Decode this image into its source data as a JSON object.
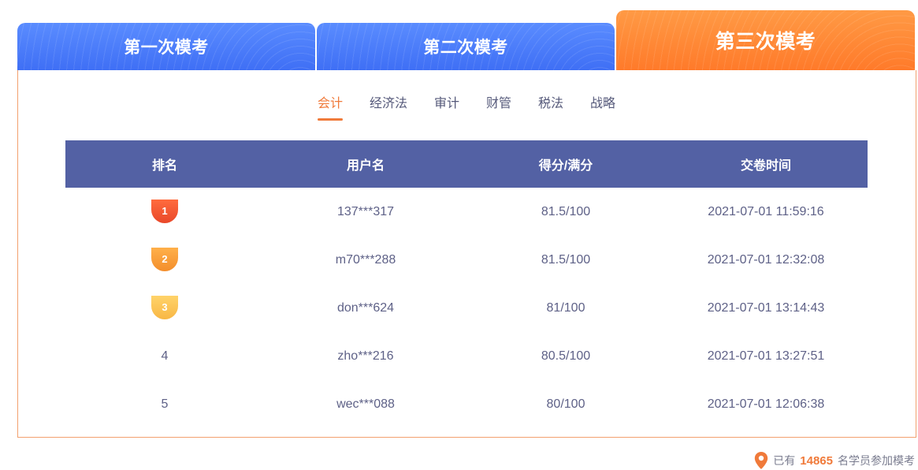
{
  "exam_tabs": [
    {
      "label": "第一次模考"
    },
    {
      "label": "第二次模考"
    },
    {
      "label": "第三次模考",
      "active": true
    }
  ],
  "subjects": [
    "会计",
    "经济法",
    "审计",
    "财管",
    "税法",
    "战略"
  ],
  "active_subject": "会计",
  "table": {
    "headers": [
      "排名",
      "用户名",
      "得分/满分",
      "交卷时间"
    ],
    "rows": [
      {
        "rank": "1",
        "user": "137***317",
        "score": "81.5/100",
        "time": "2021-07-01 11:59:16"
      },
      {
        "rank": "2",
        "user": "m70***288",
        "score": "81.5/100",
        "time": "2021-07-01 12:32:08"
      },
      {
        "rank": "3",
        "user": "don***624",
        "score": "81/100",
        "time": "2021-07-01 13:14:43"
      },
      {
        "rank": "4",
        "user": "zho***216",
        "score": "80.5/100",
        "time": "2021-07-01 13:27:51"
      },
      {
        "rank": "5",
        "user": "wec***088",
        "score": "80/100",
        "time": "2021-07-01 12:06:38"
      }
    ]
  },
  "footer": {
    "prefix": "已有",
    "count": "14865",
    "suffix": "名学员参加模考"
  },
  "colors": {
    "accent": "#f07a3a",
    "header_bg": "#5361a4",
    "medal_1": "#f25a2f",
    "medal_2": "#f7a23a",
    "medal_3": "#fcc45a",
    "location_icon": "location-pin-icon"
  }
}
